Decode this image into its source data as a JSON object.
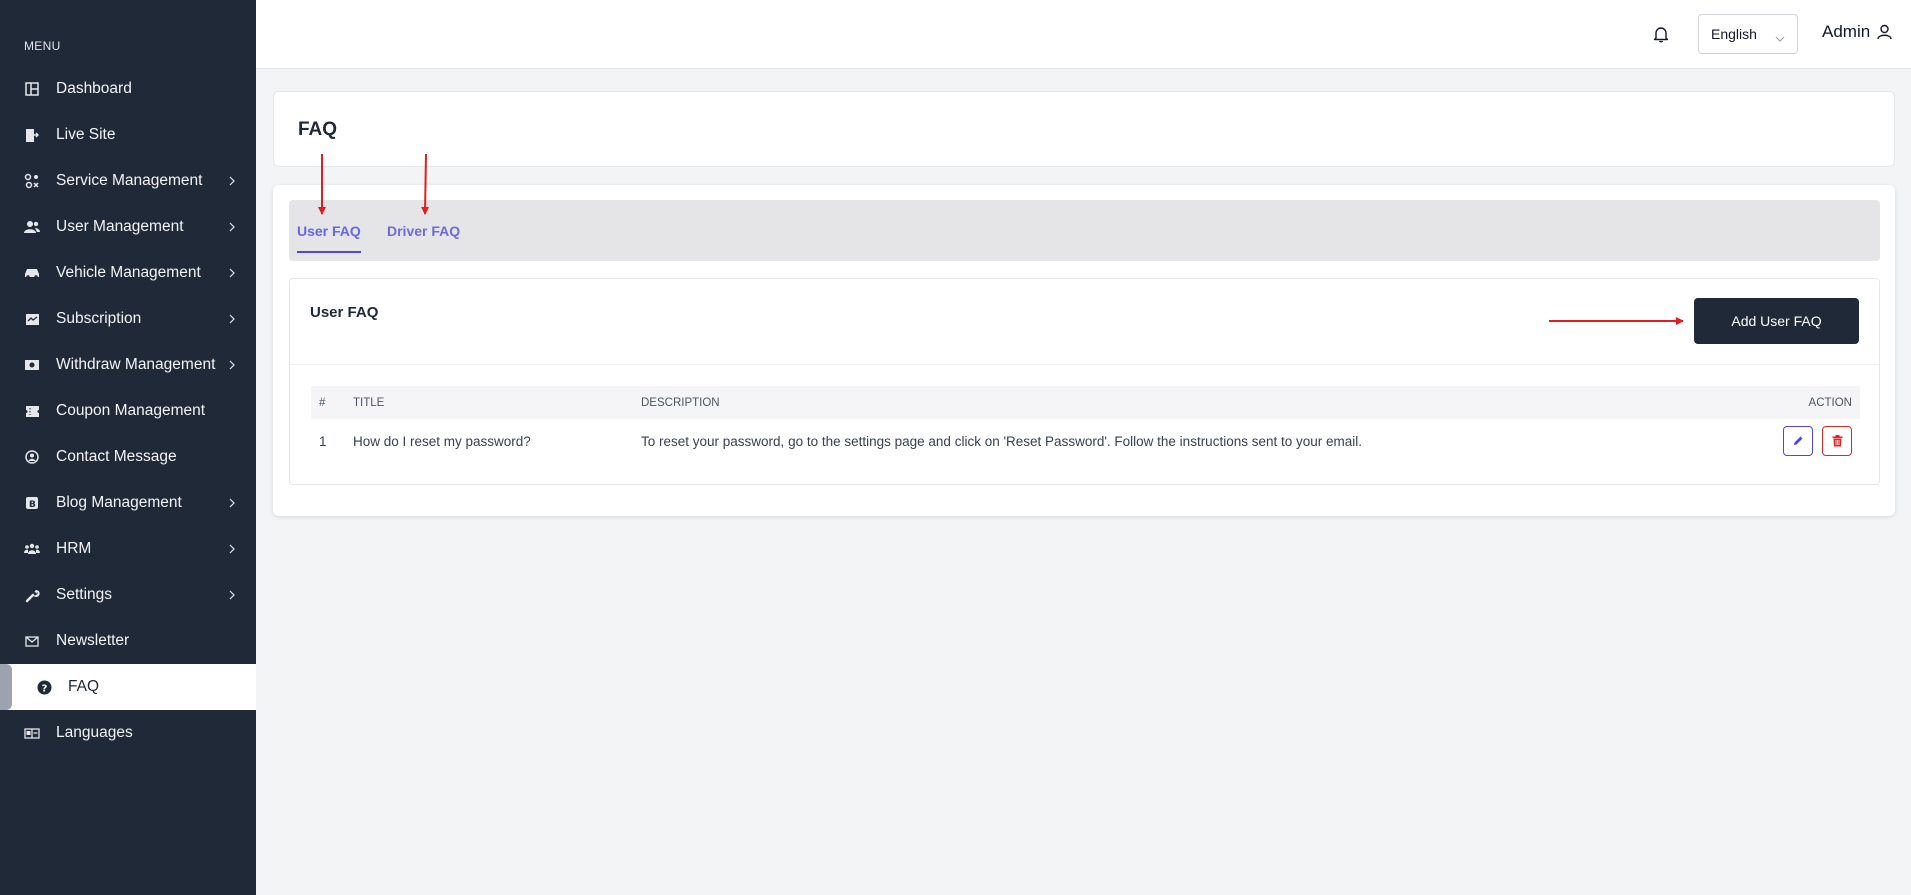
{
  "sidebar": {
    "heading": "MENU",
    "items": [
      {
        "label": "Dashboard",
        "icon": "dashboard-icon",
        "has_submenu": false
      },
      {
        "label": "Live Site",
        "icon": "external-site-icon",
        "has_submenu": false
      },
      {
        "label": "Service Management",
        "icon": "service-icon",
        "has_submenu": true
      },
      {
        "label": "User Management",
        "icon": "users-icon",
        "has_submenu": true
      },
      {
        "label": "Vehicle Management",
        "icon": "car-icon",
        "has_submenu": true
      },
      {
        "label": "Subscription",
        "icon": "subscription-icon",
        "has_submenu": true
      },
      {
        "label": "Withdraw Management",
        "icon": "money-icon",
        "has_submenu": true
      },
      {
        "label": "Coupon Management",
        "icon": "coupon-icon",
        "has_submenu": false
      },
      {
        "label": "Contact Message",
        "icon": "contact-icon",
        "has_submenu": false
      },
      {
        "label": "Blog Management",
        "icon": "blog-icon",
        "has_submenu": true
      },
      {
        "label": "HRM",
        "icon": "team-icon",
        "has_submenu": true
      },
      {
        "label": "Settings",
        "icon": "wrench-icon",
        "has_submenu": true
      },
      {
        "label": "Newsletter",
        "icon": "envelope-icon",
        "has_submenu": false
      },
      {
        "label": "FAQ",
        "icon": "question-circle-icon",
        "has_submenu": false,
        "active": true
      },
      {
        "label": "Languages",
        "icon": "language-icon",
        "has_submenu": false
      }
    ]
  },
  "topbar": {
    "language": "English",
    "user": "Admin"
  },
  "page": {
    "title": "FAQ"
  },
  "tabs": [
    {
      "label": "User FAQ",
      "active": true
    },
    {
      "label": "Driver FAQ",
      "active": false
    }
  ],
  "section": {
    "title": "User FAQ",
    "add_button": "Add User FAQ"
  },
  "table": {
    "headers": [
      "#",
      "TITLE",
      "DESCRIPTION",
      "ACTION"
    ],
    "rows": [
      {
        "num": "1",
        "title": "How do I reset my password?",
        "description": "To reset your password, go to the settings page and click on 'Reset Password'. Follow the instructions sent to your email."
      }
    ]
  },
  "colors": {
    "sidebar_bg": "#1f2937",
    "accent": "#4f46e5",
    "danger": "#dc2626",
    "annotation": "#e11d1d"
  }
}
